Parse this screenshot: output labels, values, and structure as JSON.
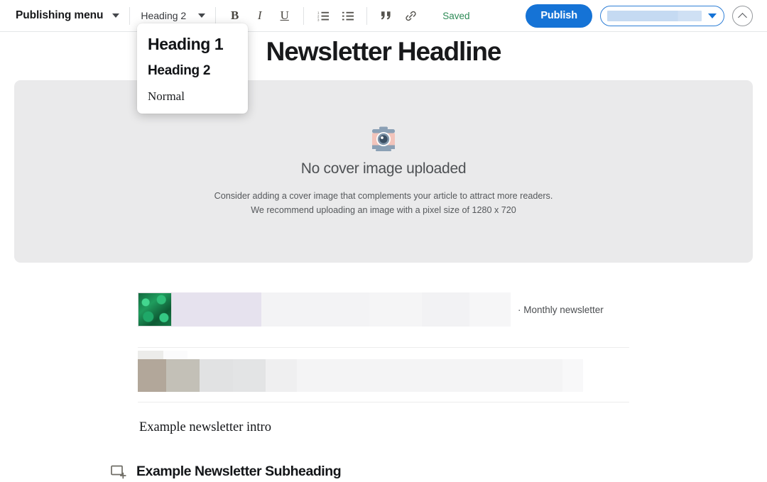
{
  "toolbar": {
    "publishing_menu_label": "Publishing menu",
    "publishing_menu_icon": "chevron-down-icon",
    "style_select_value": "Heading 2",
    "style_select_icon": "chevron-down-icon",
    "format_buttons": [
      {
        "label": "B",
        "name": "bold-button",
        "icon": "bold-icon"
      },
      {
        "label": "I",
        "name": "italic-button",
        "icon": "italic-icon"
      },
      {
        "label": "U",
        "name": "underline-button",
        "icon": "underline-icon"
      }
    ],
    "list_buttons": [
      {
        "name": "ordered-list-button",
        "icon": "ordered-list-icon"
      },
      {
        "name": "bulleted-list-button",
        "icon": "bulleted-list-icon"
      }
    ],
    "insert_buttons": [
      {
        "name": "blockquote-button",
        "icon": "quote-icon"
      },
      {
        "name": "link-button",
        "icon": "link-icon"
      }
    ],
    "save_status": "Saved",
    "save_status_color": "#2e8b57",
    "publish_label": "Publish",
    "publish_color": "#1573d6",
    "audience_select_value": "",
    "audience_select_icon": "caret-down-icon",
    "collapse_icon": "chevron-up-icon"
  },
  "style_menu": {
    "items": [
      {
        "label": "Heading 1",
        "style": "h1"
      },
      {
        "label": "Heading 2",
        "style": "h2"
      },
      {
        "label": "Normal",
        "style": "normal"
      }
    ]
  },
  "editor": {
    "headline": "Newsletter Headline",
    "cover": {
      "icon": "camera-icon",
      "title": "No cover image uploaded",
      "line1": "Consider adding a cover image that complements your article to attract more readers.",
      "line2": "We recommend uploading an image with a pixel size of 1280 x 720"
    },
    "embed_block": {
      "thumbnail_icon": "leaf-photo-thumbnail",
      "caption": "· Monthly newsletter"
    },
    "intro_text": "Example newsletter intro",
    "subheading": "Example Newsletter Subheading",
    "subheading_icon": "add-image-block-icon"
  }
}
